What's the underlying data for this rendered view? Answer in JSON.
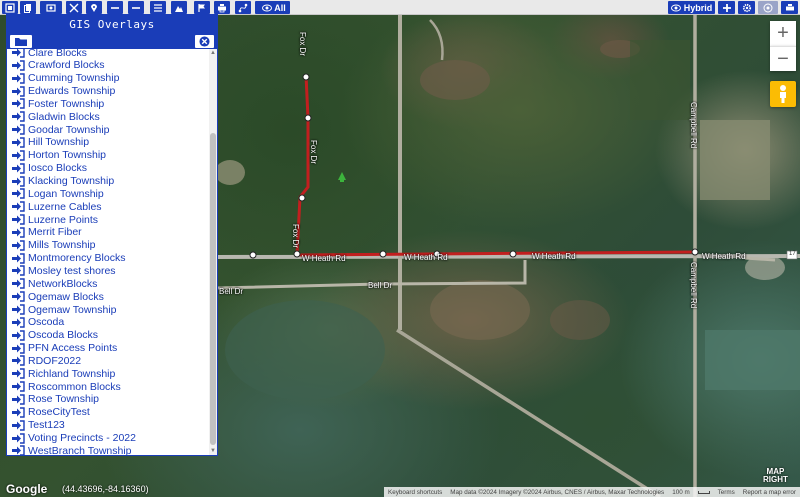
{
  "toolbar": {
    "left_buttons": [
      "gis-overlays",
      "copy",
      "view",
      "tools",
      "marker",
      "measure-line",
      "list",
      "mountain",
      "flag",
      "print",
      "route",
      "ruler"
    ],
    "all_label": "All",
    "hybrid_label": "Hybrid"
  },
  "panel": {
    "title": "GIS Overlays",
    "items": [
      "Clare Blocks",
      "Crawford Blocks",
      "Cumming Township",
      "Edwards Township",
      "Foster Township",
      "Gladwin Blocks",
      "Goodar Township",
      "Hill Township",
      "Horton Township",
      "Iosco Blocks",
      "Klacking Township",
      "Logan Township",
      "Luzerne Cables",
      "Luzerne Points",
      "Merrit Fiber",
      "Mills Township",
      "Montmorency Blocks",
      "Mosley test shores",
      "NetworkBlocks",
      "Ogemaw Blocks",
      "Ogemaw Township",
      "Oscoda",
      "Oscoda Blocks",
      "PFN Access Points",
      "RDOF2022",
      "Richland Township",
      "Roscommon Blocks",
      "Rose Township",
      "RoseCityTest",
      "Test123",
      "Voting Precincts - 2022",
      "WestBranch Township"
    ]
  },
  "map": {
    "roads": {
      "fox_dr": "Fox Dr",
      "w_heath_rd": "W Heath Rd",
      "bell_dr": "Bell Dr",
      "campbell_rd": "Campbell Rd",
      "route_number": "17"
    },
    "zoom_in": "+",
    "zoom_out": "−"
  },
  "footer": {
    "google": "Google",
    "coords": "(44.43696,-84.16360)",
    "keyboard_shortcuts": "Keyboard shortcuts",
    "map_data": "Map data ©2024 Imagery ©2024 Airbus, CNES / Airbus, Maxar Technologies",
    "scale": "100 m",
    "terms": "Terms",
    "report": "Report a map error",
    "brand_top": "MAP",
    "brand_bottom": "RIGHT"
  },
  "colors": {
    "accent": "#1a3db8",
    "route_line": "#c21f1f"
  }
}
